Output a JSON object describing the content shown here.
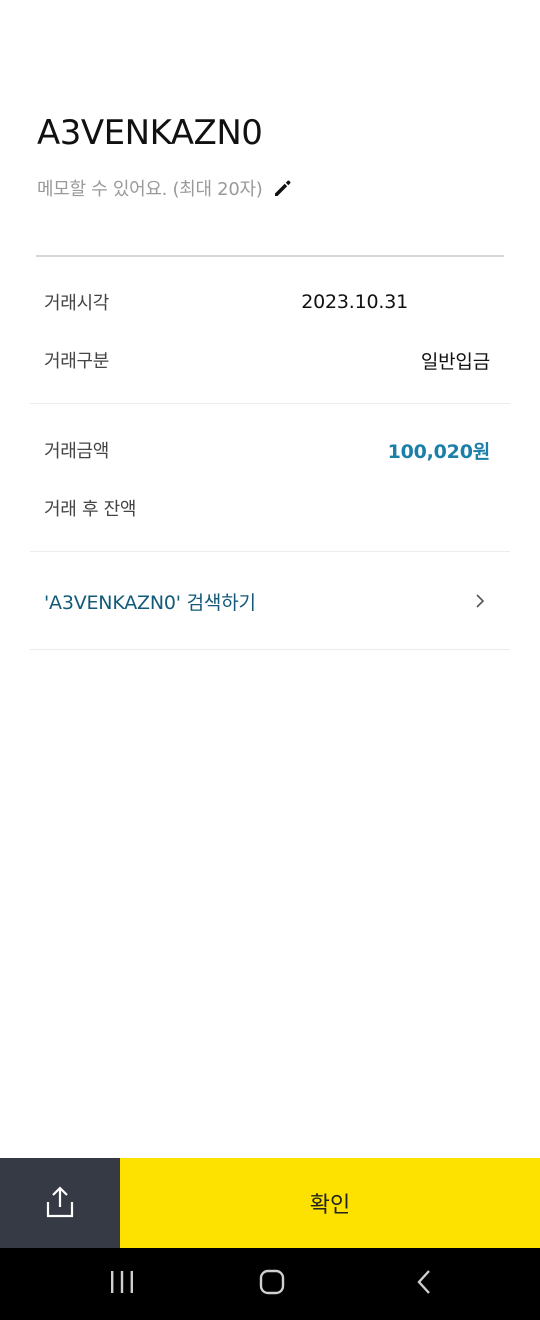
{
  "detail": {
    "title": "A3VENKAZN0",
    "memo_placeholder": "메모할 수 있어요. (최대 20자)",
    "rows": [
      {
        "label": "거래시각",
        "value": "2023.10.31"
      },
      {
        "label": "거래구분",
        "value": "일반입금"
      },
      {
        "label": "거래금액",
        "value": "100,020원"
      },
      {
        "label": "거래 후 잔액",
        "value": ""
      }
    ],
    "search_link": "'A3VENKAZN0' 검색하기"
  },
  "footer": {
    "confirm_label": "확인"
  },
  "icons": {
    "memo_edit": "pencil-icon",
    "search_chevron": "chevron-right-icon",
    "share": "share-icon",
    "nav_recent": "recent-apps-icon",
    "nav_home": "home-icon",
    "nav_back": "back-icon"
  },
  "colors": {
    "accent_amount": "#1b7fa8",
    "link": "#135a78",
    "confirm_bg": "#fde200",
    "share_bg": "#353a44"
  }
}
